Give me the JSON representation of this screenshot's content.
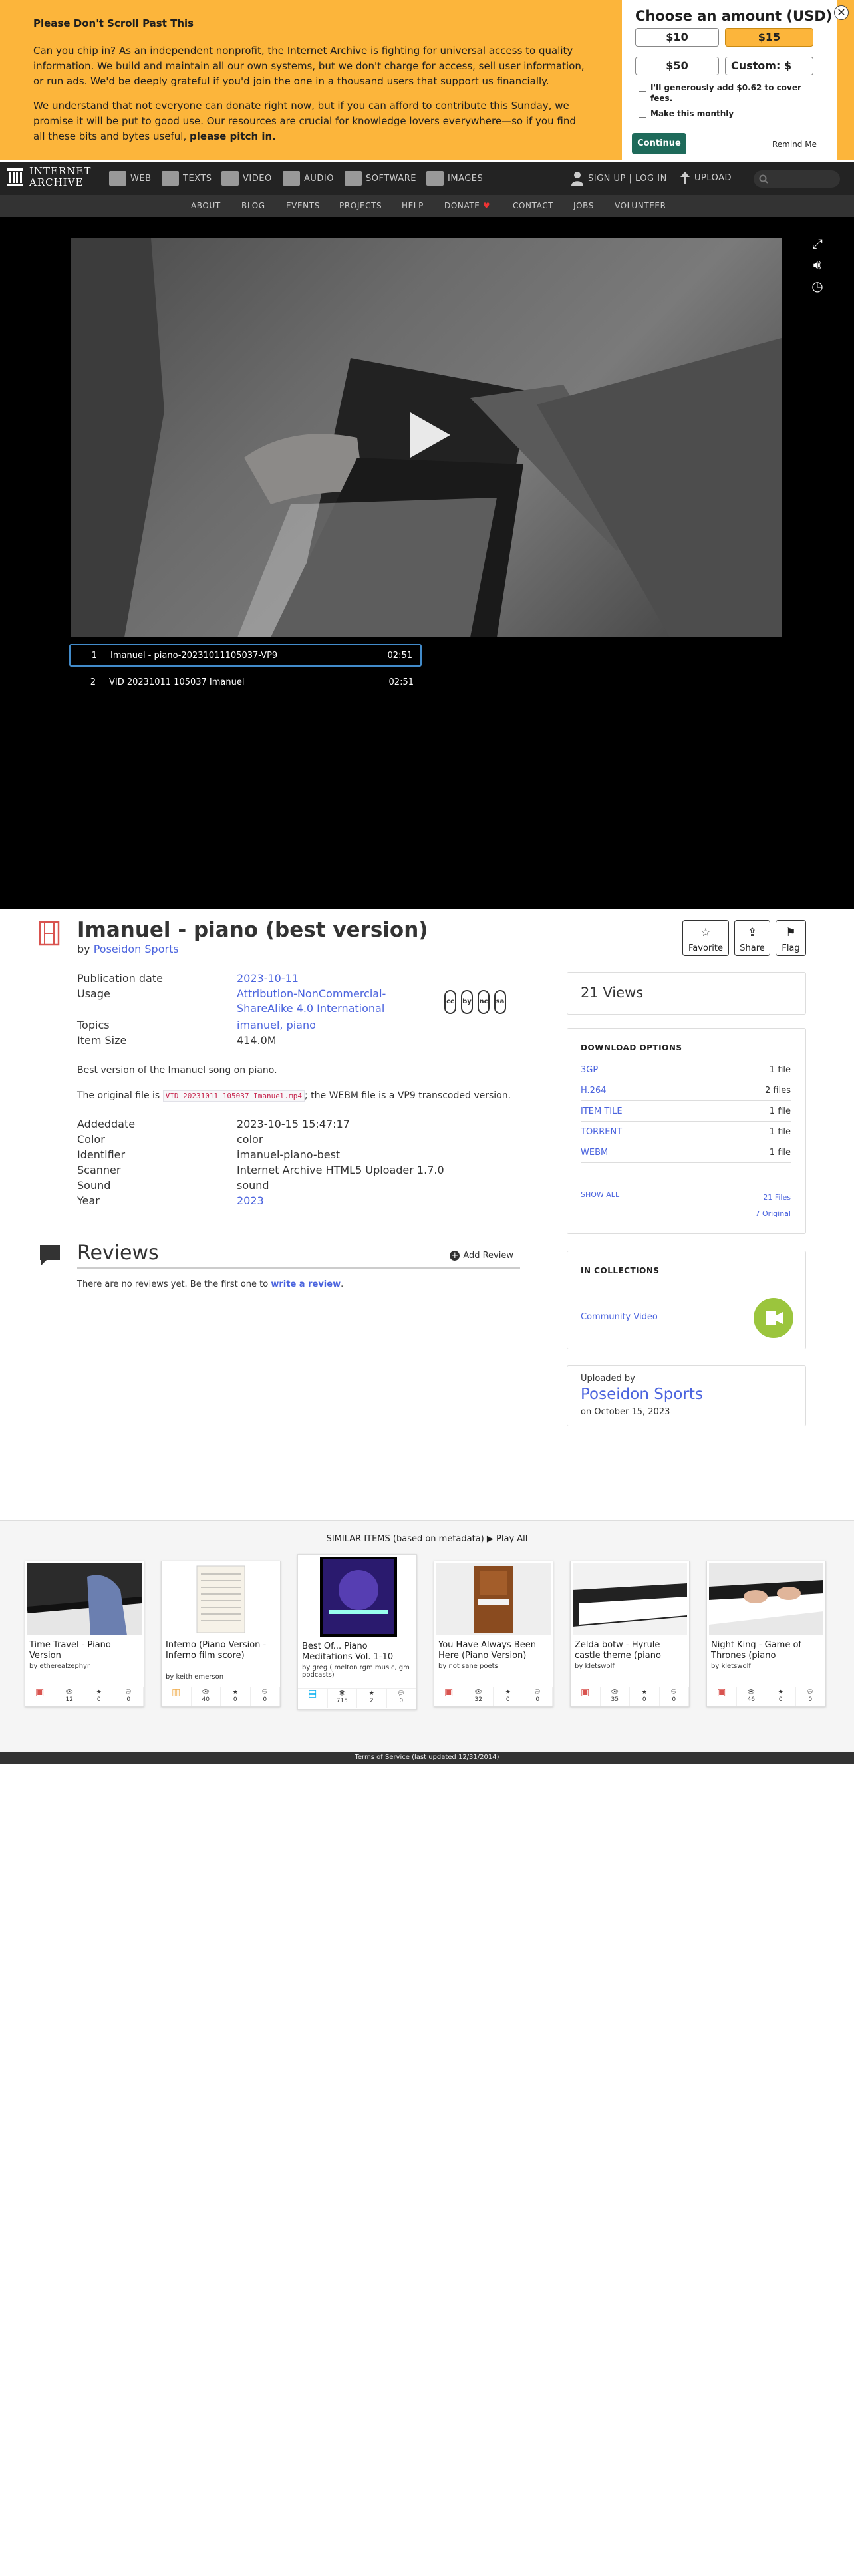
{
  "banner": {
    "heading": "Please Don't Scroll Past This",
    "para1": "Can you chip in? As an independent nonprofit, the Internet Archive is fighting for universal access to quality information. We build and maintain all our own systems, but we don't charge for access, sell user information, or run ads. We'd be deeply grateful if you'd join the one in a thousand users that support us financially.",
    "para2": "We understand that not everyone can donate right now, but if you can afford to contribute this Sunday, we promise it will be put to good use. Our resources are crucial for knowledge lovers everywhere—so if you find all these bits and bytes useful,",
    "para2_bold": "please pitch in.",
    "panel_title": "Choose an amount (USD)",
    "amounts": [
      "$10",
      "$15",
      "$50",
      "Custom: $"
    ],
    "selected_amount": "$15",
    "fee_label": "I'll generously add $0.62 to cover fees.",
    "monthly_label": "Make this monthly",
    "continue_label": "Continue",
    "remind_label": "Remind Me",
    "close_glyph": "✕"
  },
  "nav": {
    "logo_line1": "INTERNET",
    "logo_line2": "ARCHIVE",
    "items": [
      "WEB",
      "TEXTS",
      "VIDEO",
      "AUDIO",
      "SOFTWARE",
      "IMAGES"
    ],
    "signin": "SIGN UP | LOG IN",
    "upload": "UPLOAD",
    "sub_items": [
      "ABOUT",
      "BLOG",
      "EVENTS",
      "PROJECTS",
      "HELP",
      "DONATE",
      "CONTACT",
      "JOBS",
      "VOLUNTEER"
    ]
  },
  "player": {
    "playlist": [
      {
        "num": "1",
        "title": "Imanuel - piano-20231011105037-VP9",
        "duration": "02:51"
      },
      {
        "num": "2",
        "title": "VID 20231011 105037 Imanuel",
        "duration": "02:51"
      }
    ]
  },
  "item": {
    "title": "Imanuel - piano (best version)",
    "by_prefix": "by",
    "creator": "Poseidon Sports",
    "actions": [
      "Favorite",
      "Share",
      "Flag"
    ],
    "metadata": [
      {
        "key": "Publication date",
        "value": "2023-10-11",
        "link": true
      },
      {
        "key": "Usage",
        "value": "Attribution-NonCommercial-ShareAlike 4.0 International",
        "link": true
      },
      {
        "key": "Topics",
        "value": "imanuel, piano",
        "link": true
      },
      {
        "key": "Item Size",
        "value": "414.0M",
        "link": false
      }
    ],
    "cc_icons": [
      "cc",
      "by",
      "nc",
      "sa"
    ],
    "description": "Best version of the Imanuel song on piano.",
    "original_prefix": "The original file is",
    "original_file": "VID_20231011_105037_Imanuel.mp4",
    "original_suffix": "; the WEBM file is a VP9 transcoded version.",
    "metadata2": [
      {
        "key": "Addeddate",
        "value": "2023-10-15 15:47:17",
        "link": false
      },
      {
        "key": "Color",
        "value": "color",
        "link": false
      },
      {
        "key": "Identifier",
        "value": "imanuel-piano-best",
        "link": false
      },
      {
        "key": "Scanner",
        "value": "Internet Archive HTML5 Uploader 1.7.0",
        "link": false
      },
      {
        "key": "Sound",
        "value": "sound",
        "link": false
      },
      {
        "key": "Year",
        "value": "2023",
        "link": true
      }
    ]
  },
  "reviews": {
    "title": "Reviews",
    "add_label": "Add Review",
    "empty_text": "There are no reviews yet. Be the first one to",
    "write_link": "write a review"
  },
  "sidebar": {
    "views": "21 Views",
    "download_title": "DOWNLOAD OPTIONS",
    "downloads": [
      {
        "label": "3GP",
        "count": "1 file"
      },
      {
        "label": "H.264",
        "count": "2 files"
      },
      {
        "label": "ITEM TILE",
        "count": "1 file"
      },
      {
        "label": "TORRENT",
        "count": "1 file"
      },
      {
        "label": "WEBM",
        "count": "1 file"
      }
    ],
    "show_all": "SHOW ALL",
    "total_files": "21 Files",
    "original_files": "7 Original",
    "collections_title": "IN COLLECTIONS",
    "collection": "Community Video",
    "uploaded_by_label": "Uploaded by",
    "uploader": "Poseidon Sports",
    "uploaded_on": "on October 15, 2023"
  },
  "similar": {
    "heading": "SIMILAR ITEMS (based on metadata)",
    "play_all": "Play All",
    "cards": [
      {
        "title": "Time Travel - Piano Version",
        "by": "by etherealzephyr",
        "views": "12",
        "favs": "0",
        "reviews": "0",
        "media": "video"
      },
      {
        "title": "Inferno (Piano Version - Inferno film score)",
        "by": "by keith emerson",
        "views": "40",
        "favs": "0",
        "reviews": "0",
        "media": "texts"
      },
      {
        "title": "Best Of... Piano Meditations Vol. 1-10",
        "by": "by greg ( melton rgm music, gm podcasts)",
        "views": "715",
        "favs": "2",
        "reviews": "0",
        "media": "audio"
      },
      {
        "title": "You Have Always Been Here (Piano Version)",
        "by": "by not sane poets",
        "views": "32",
        "favs": "0",
        "reviews": "0",
        "media": "video"
      },
      {
        "title": "Zelda botw - Hyrule castle theme (piano",
        "by": "by kletswolf",
        "views": "35",
        "favs": "0",
        "reviews": "0",
        "media": "video"
      },
      {
        "title": "Night King - Game of Thrones (piano",
        "by": "by kletswolf",
        "views": "46",
        "favs": "0",
        "reviews": "0",
        "media": "video"
      }
    ]
  },
  "footer": {
    "tos": "Terms of Service (last updated 12/31/2014)"
  }
}
